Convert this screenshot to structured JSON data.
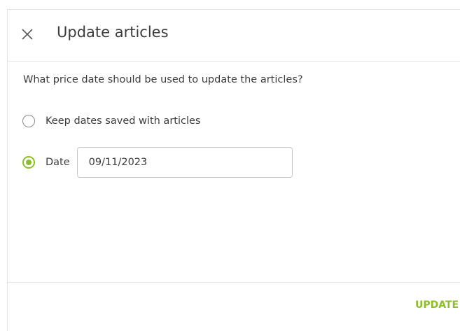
{
  "dialog": {
    "title": "Update articles",
    "question": "What price date should be used to update the articles?",
    "options": [
      {
        "label": "Keep dates saved with articles",
        "selected": false
      },
      {
        "label": "Date",
        "selected": true
      }
    ],
    "date_value": "09/11/2023",
    "update_label": "UPDATE",
    "close_icon": "close-icon",
    "accent_color": "#8cbf26"
  }
}
